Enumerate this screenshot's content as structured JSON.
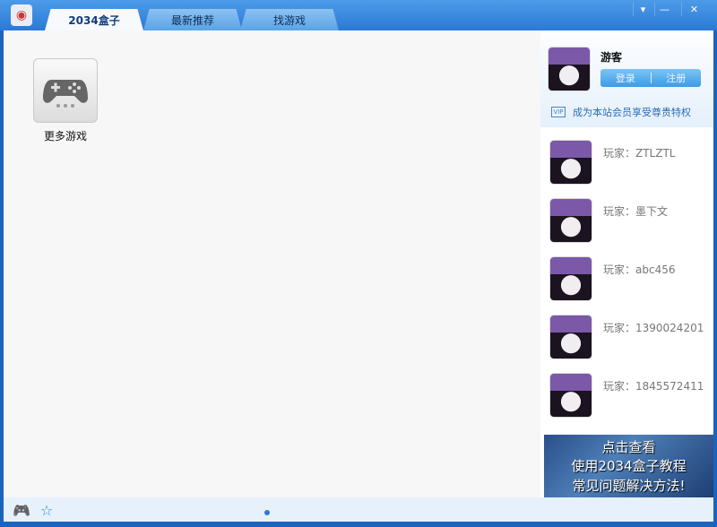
{
  "tabs": [
    {
      "label": "2034盒子",
      "active": true
    },
    {
      "label": "最新推荐"
    },
    {
      "label": "找游戏"
    }
  ],
  "window_controls": {
    "menu": "▾",
    "minimize": "—",
    "close": "✕"
  },
  "games": [
    {
      "label": "更多游戏",
      "icon": "gamepad-icon"
    }
  ],
  "user": {
    "name": "游客",
    "login": "登录",
    "register": "注册",
    "vip_text": "成为本站会员享受尊贵特权"
  },
  "players": [
    {
      "label": "玩家：ZTLZTL"
    },
    {
      "label": "玩家：墨下文"
    },
    {
      "label": "玩家：abc456"
    },
    {
      "label": "玩家：1390024201"
    },
    {
      "label": "玩家：1845572411"
    }
  ],
  "banner": {
    "line1": "点击查看",
    "line2": "使用2034盒子教程",
    "line3": "常见问题解决方法!"
  }
}
